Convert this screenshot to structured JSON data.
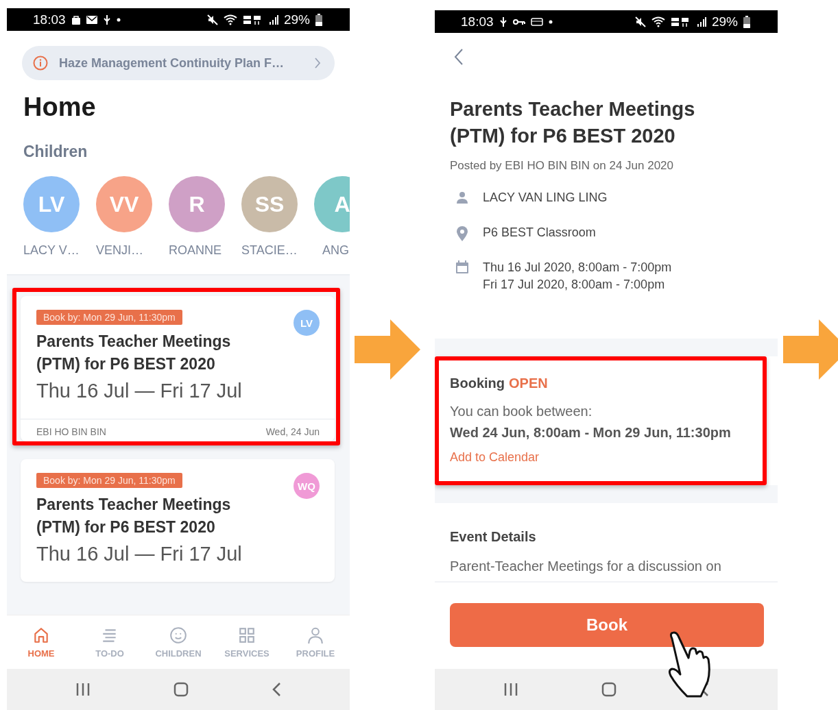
{
  "home_screen": {
    "status_bar": {
      "time": "18:03",
      "battery": "29%"
    },
    "notice": {
      "text": "Haze Management Continuity Plan F…"
    },
    "title": "Home",
    "children_heading": "Children",
    "children": [
      {
        "initials": "LV",
        "name": "LACY V…",
        "color": "#8fbff5"
      },
      {
        "initials": "VV",
        "name": "VENJI…",
        "color": "#f7a388"
      },
      {
        "initials": "R",
        "name": "ROANNE",
        "color": "#cfa0c6"
      },
      {
        "initials": "SS",
        "name": "STACIE…",
        "color": "#c9bba8"
      },
      {
        "initials": "A",
        "name": "ANG",
        "color": "#7ec8c8"
      }
    ],
    "cards": [
      {
        "tag": "Book by: Mon 29 Jun, 11:30pm",
        "title": "Parents Teacher Meetings (PTM) for P6 BEST 2020",
        "dates": "Thu 16 Jul — Fri 17 Jul",
        "avatar": {
          "initials": "LV",
          "color": "#8fbff5"
        },
        "author": "EBI HO BIN BIN",
        "posted": "Wed, 24 Jun",
        "highlighted": true
      },
      {
        "tag": "Book by: Mon 29 Jun, 11:30pm",
        "title": "Parents Teacher Meetings (PTM) for P6 BEST 2020",
        "dates": "Thu 16 Jul — Fri 17 Jul",
        "avatar": {
          "initials": "WQ",
          "color": "#f09ad6"
        },
        "highlighted": false
      }
    ],
    "nav": [
      {
        "label": "HOME",
        "selected": true
      },
      {
        "label": "TO-DO",
        "selected": false
      },
      {
        "label": "CHILDREN",
        "selected": false
      },
      {
        "label": "SERVICES",
        "selected": false
      },
      {
        "label": "PROFILE",
        "selected": false
      }
    ]
  },
  "detail_screen": {
    "status_bar": {
      "time": "18:03",
      "battery": "29%"
    },
    "title": "Parents Teacher Meetings (PTM) for P6 BEST 2020",
    "posted": "Posted by EBI HO BIN BIN on 24 Jun 2020",
    "info": [
      {
        "kind": "person",
        "lines": [
          "LACY VAN LING LING"
        ]
      },
      {
        "kind": "location",
        "lines": [
          "P6 BEST Classroom"
        ]
      },
      {
        "kind": "calendar",
        "lines": [
          "Thu 16 Jul 2020, 8:00am - 7:00pm",
          "Fri 17 Jul 2020, 8:00am - 7:00pm"
        ]
      }
    ],
    "booking": {
      "label": "Booking",
      "status": "OPEN",
      "intro": "You can book between:",
      "window": "Wed 24 Jun, 8:00am - Mon 29 Jun, 11:30pm",
      "link": "Add to Calendar",
      "highlighted": true
    },
    "details_heading": "Event Details",
    "description": "Parent-Teacher Meetings for a discussion on",
    "button": "Book"
  }
}
